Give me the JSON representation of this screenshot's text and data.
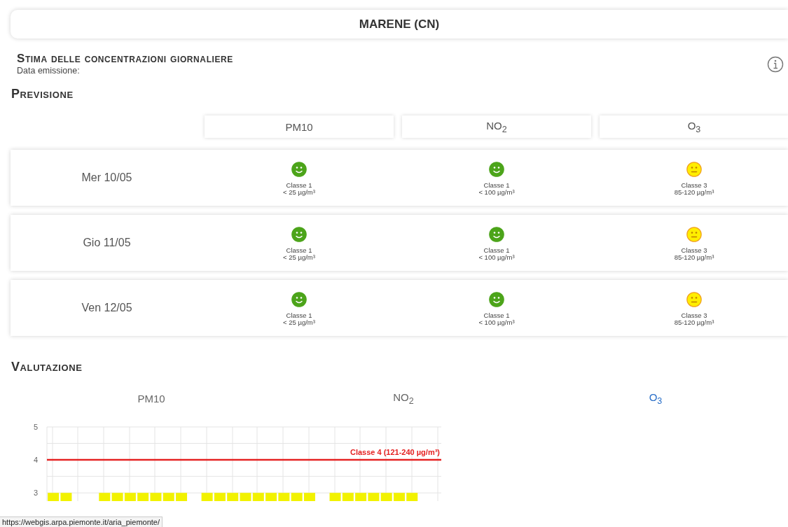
{
  "station": {
    "title": "MARENE (CN)"
  },
  "estimate": {
    "heading": "Stima delle concentrazioni giornaliere",
    "issue_label": "Data emissione:"
  },
  "forecast": {
    "heading": "Previsione",
    "columns": [
      "PM10",
      "NO$_{2}$",
      "O$_{3}$"
    ],
    "rows": [
      {
        "date": "Mer 10/05",
        "cells": [
          {
            "kind": "good",
            "class": "Classe 1",
            "range": "< 25 µg/m³"
          },
          {
            "kind": "good",
            "class": "Classe 1",
            "range": "< 100 µg/m³"
          },
          {
            "kind": "moderate",
            "class": "Classe 3",
            "range": "85-120 µg/m³"
          }
        ]
      },
      {
        "date": "Gio 11/05",
        "cells": [
          {
            "kind": "good",
            "class": "Classe 1",
            "range": "< 25 µg/m³"
          },
          {
            "kind": "good",
            "class": "Classe 1",
            "range": "< 100 µg/m³"
          },
          {
            "kind": "moderate",
            "class": "Classe 3",
            "range": "85-120 µg/m³"
          }
        ]
      },
      {
        "date": "Ven 12/05",
        "cells": [
          {
            "kind": "good",
            "class": "Classe 1",
            "range": "< 25 µg/m³"
          },
          {
            "kind": "good",
            "class": "Classe 1",
            "range": "< 100 µg/m³"
          },
          {
            "kind": "moderate",
            "class": "Classe 3",
            "range": "85-120 µg/m³"
          }
        ]
      }
    ]
  },
  "assessment": {
    "heading": "Valutazione",
    "tabs": [
      {
        "label": "PM10",
        "selected": false
      },
      {
        "label": "NO$_{2}$",
        "selected": false
      },
      {
        "label": "O$_{3}$",
        "selected": true
      }
    ],
    "chart_data": {
      "type": "bar",
      "ylim": [
        2.75,
        5
      ],
      "yticks": [
        3,
        4,
        5
      ],
      "grid": true,
      "series": [
        {
          "color": "#f2f200",
          "values": [
            3,
            3,
            null,
            null,
            3,
            3,
            3,
            3,
            3,
            3,
            3,
            null,
            3,
            3,
            3,
            3,
            3,
            3,
            3,
            3,
            3,
            null,
            3,
            3,
            3,
            3,
            3,
            3,
            3,
            null,
            null
          ]
        }
      ],
      "ref_lines": [
        {
          "axis": "y",
          "value": 4,
          "label": "Classe 4 (121-240 µg/m³)",
          "color": "#e52222"
        }
      ]
    }
  },
  "status_bar": {
    "url": "https://webgis.arpa.piemonte.it/aria_piemonte/"
  }
}
